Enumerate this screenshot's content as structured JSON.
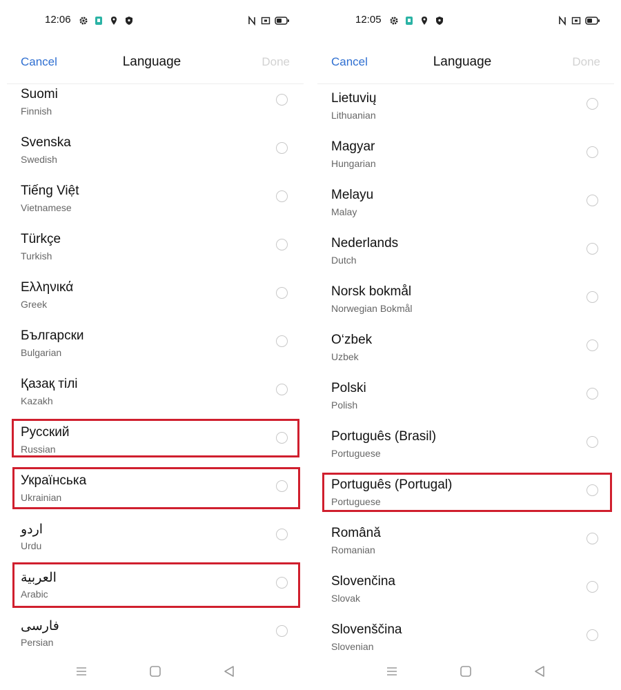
{
  "screens": [
    {
      "status": {
        "time": "12:06"
      },
      "header": {
        "cancel": "Cancel",
        "title": "Language",
        "done": "Done"
      },
      "languages": [
        {
          "native": "Suomi",
          "english": "Finnish",
          "selected": false,
          "highlighted": false
        },
        {
          "native": "Svenska",
          "english": "Swedish",
          "selected": false,
          "highlighted": false
        },
        {
          "native": "Tiếng Việt",
          "english": "Vietnamese",
          "selected": false,
          "highlighted": false
        },
        {
          "native": "Türkçe",
          "english": "Turkish",
          "selected": false,
          "highlighted": false
        },
        {
          "native": "Ελληνικά",
          "english": "Greek",
          "selected": false,
          "highlighted": false
        },
        {
          "native": "Български",
          "english": "Bulgarian",
          "selected": false,
          "highlighted": false
        },
        {
          "native": "Қазақ тілі",
          "english": "Kazakh",
          "selected": false,
          "highlighted": false
        },
        {
          "native": "Русский",
          "english": "Russian",
          "selected": false,
          "highlighted": true
        },
        {
          "native": "Українська",
          "english": "Ukrainian",
          "selected": false,
          "highlighted": true
        },
        {
          "native": "اردو",
          "english": "Urdu",
          "selected": false,
          "highlighted": false,
          "rtl": true
        },
        {
          "native": "العربية",
          "english": "Arabic",
          "selected": false,
          "highlighted": true,
          "rtl": true
        },
        {
          "native": "فارسی",
          "english": "Persian",
          "selected": false,
          "highlighted": false,
          "rtl": true
        }
      ]
    },
    {
      "status": {
        "time": "12:05"
      },
      "header": {
        "cancel": "Cancel",
        "title": "Language",
        "done": "Done"
      },
      "languages": [
        {
          "native": "Lietuvių",
          "english": "Lithuanian",
          "selected": false,
          "highlighted": false
        },
        {
          "native": "Magyar",
          "english": "Hungarian",
          "selected": false,
          "highlighted": false
        },
        {
          "native": "Melayu",
          "english": "Malay",
          "selected": false,
          "highlighted": false
        },
        {
          "native": "Nederlands",
          "english": "Dutch",
          "selected": false,
          "highlighted": false
        },
        {
          "native": "Norsk bokmål",
          "english": "Norwegian Bokmål",
          "selected": false,
          "highlighted": false
        },
        {
          "native": "O‘zbek",
          "english": "Uzbek",
          "selected": false,
          "highlighted": false
        },
        {
          "native": "Polski",
          "english": "Polish",
          "selected": false,
          "highlighted": false
        },
        {
          "native": "Português (Brasil)",
          "english": "Portuguese",
          "selected": false,
          "highlighted": false
        },
        {
          "native": "Português (Portugal)",
          "english": "Portuguese",
          "selected": false,
          "highlighted": true
        },
        {
          "native": "Română",
          "english": "Romanian",
          "selected": false,
          "highlighted": false
        },
        {
          "native": "Slovenčina",
          "english": "Slovak",
          "selected": false,
          "highlighted": false
        },
        {
          "native": "Slovenščina",
          "english": "Slovenian",
          "selected": false,
          "highlighted": false
        }
      ]
    }
  ],
  "icons": {
    "status_left": [
      "settings-icon",
      "app-notification-icon",
      "location-icon",
      "shield-icon"
    ],
    "status_right": [
      "nfc-icon",
      "screen-cast-icon",
      "battery-icon"
    ],
    "nav": [
      "menu-icon",
      "home-icon",
      "back-icon"
    ]
  },
  "colors": {
    "accent": "#2f6fd1",
    "done_disabled": "#d2d2d2",
    "highlight_border": "#d01f2e",
    "radio_border": "#c8c8c8",
    "app_icon_teal": "#2bb3a5"
  }
}
